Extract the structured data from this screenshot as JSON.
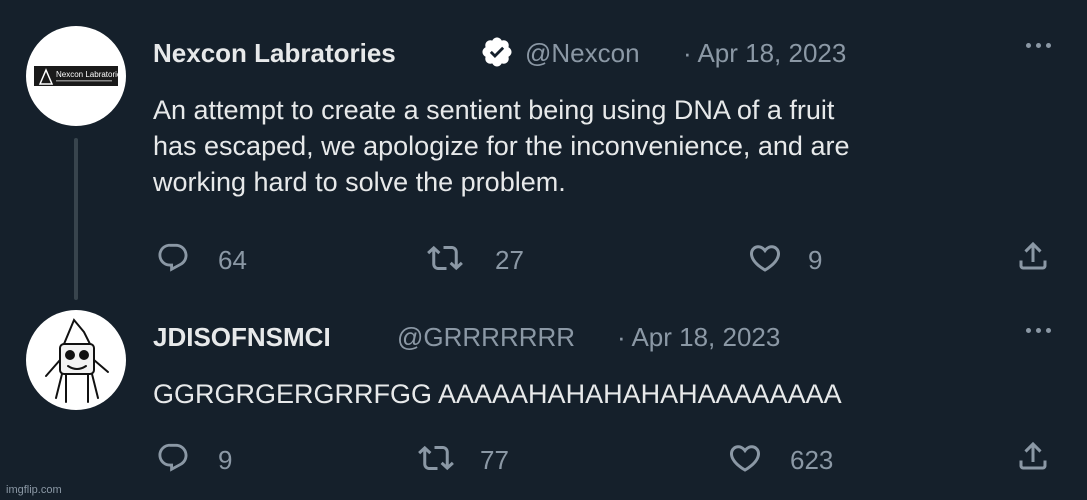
{
  "tweets": [
    {
      "name": "Nexcon Labratories",
      "handle": "@Nexcon",
      "date": "· Apr 18, 2023",
      "verified": true,
      "text_lines": [
        "An attempt to create a sentient being using DNA of a fruit",
        "has escaped, we apologize for the inconvenience, and are",
        "working hard to solve the problem."
      ],
      "avatar_logo_text": "Nexcon Labratories",
      "replies": "64",
      "retweets": "27",
      "likes": "9"
    },
    {
      "name": "JDISOFNSMCI",
      "handle": "@GRRRRRRR",
      "date": "· Apr 18, 2023",
      "verified": false,
      "text": "GGRGRGERGRRFGG AAAAAHAHAHAHAHAAAAAAAA",
      "replies": "9",
      "retweets": "77",
      "likes": "623"
    }
  ],
  "watermark": "imgflip.com",
  "icons": {
    "reply": "reply-icon",
    "retweet": "retweet-icon",
    "like": "heart-icon",
    "share": "share-icon",
    "more": "more-icon",
    "verified": "verified-badge-icon"
  },
  "colors": {
    "background": "#15202b",
    "text": "#e7e9ea",
    "muted": "#8b98a5"
  }
}
